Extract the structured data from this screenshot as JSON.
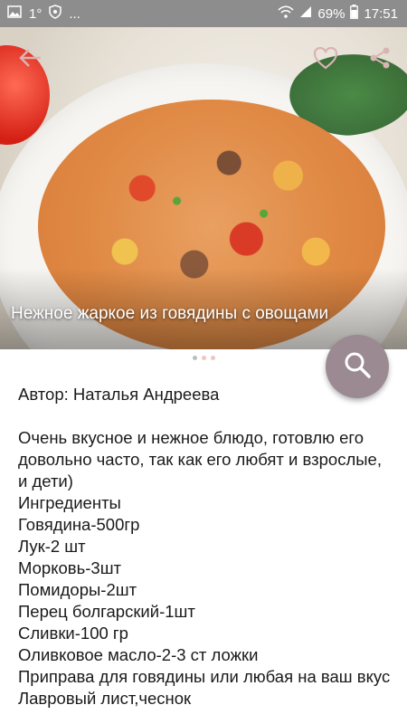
{
  "statusbar": {
    "left_text": "1°",
    "more": "...",
    "battery": "69%",
    "time": "17:51"
  },
  "hero": {
    "title": "Нежное жаркое из говядины с овощами",
    "page_count": 3,
    "active_page": 1
  },
  "recipe": {
    "author": "Автор: Наталья Андреева",
    "description": "Очень вкусное и нежное блюдо, готовлю его довольно часто, так как его любят и взрослые, и дети)",
    "lines": [
      "Ингредиенты",
      "Говядина-500гр",
      "Лук-2 шт",
      "Морковь-3шт",
      "Помидоры-2шт",
      "Перец болгарский-1шт",
      "Сливки-100 гр",
      "Оливковое масло-2-3 ст ложки",
      "Приправа для говядины или любая на ваш вкус",
      "Лавровый лист,чеснок"
    ]
  },
  "colors": {
    "statusbar_bg": "#8d8d8d",
    "fab_bg": "#9b8a92"
  },
  "icons": [
    "image-icon",
    "shield-icon",
    "wifi-icon",
    "signal-icon",
    "battery-icon",
    "back-arrow-icon",
    "heart-icon",
    "share-icon",
    "search-icon"
  ]
}
